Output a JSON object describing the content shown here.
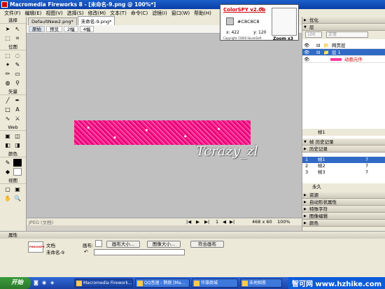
{
  "window": {
    "title": "Macromedia Fireworks 8 - [未命名-9.png @ 100%*]"
  },
  "menu": [
    "文件(F)",
    "编辑(E)",
    "视图(V)",
    "选择(S)",
    "修改(M)",
    "文本(T)",
    "命令(C)",
    "滤镜(I)",
    "窗口(W)",
    "帮助(H)"
  ],
  "tools": {
    "sections": [
      "选择",
      "位图",
      "矢量",
      "Web",
      "颜色",
      "视图"
    ]
  },
  "document": {
    "tabs": [
      "DefaultNew2.png*",
      "未命名-9.png*"
    ],
    "view_buttons": [
      "原始",
      "预览",
      "2幅",
      "4幅"
    ],
    "watermark": "Tcrazy_zl",
    "status": {
      "format": "JPEG (文档)",
      "frame": "1",
      "size": "468 x 60",
      "zoom": "100%"
    }
  },
  "colorspy": {
    "title": "ColorSPY v2.0b",
    "hex": "#C8C8C8",
    "x": "x: 422",
    "y": "y: 120",
    "copyright": "Copyright ?2000 SkunkSoft",
    "zoom_label": "Zoom x3"
  },
  "panels": {
    "optimize": "优化",
    "layers": "层",
    "layers_rows": [
      {
        "name": "网页层"
      },
      {
        "name": "层 1"
      },
      {
        "name": "动画元件"
      }
    ],
    "layers_opacity": "100",
    "layers_blend": "正常",
    "frame_count": "帧1",
    "history_tabs": "帧 历史记录",
    "history_header": "历史记录",
    "history_rows": [
      {
        "n": "1",
        "name": "帧1",
        "d": "7"
      },
      {
        "n": "2",
        "name": "帧2",
        "d": "7"
      },
      {
        "n": "3",
        "name": "帧3",
        "d": "7"
      }
    ],
    "forever": "永久",
    "collapsed": [
      "资源",
      "自动形状属性",
      "特殊字符",
      "图像编辑",
      "颜色"
    ]
  },
  "properties": {
    "header": "属性",
    "doc_label": "文档",
    "doc_name": "未命名-9",
    "canvas_label": "画布:",
    "canvas_size_btn": "画布大小...",
    "image_size_btn": "图像大小...",
    "fit_canvas_btn": "符合画布",
    "thumb_text": "PHOCOSPY"
  },
  "taskbar": {
    "start": "开始",
    "items": [
      "Macromedia Firework...",
      "QQ音速 - 鹊跑 [Ma...",
      "华藻商城",
      "未地相恩"
    ],
    "tray_text": "智可网 www.hzhike.com"
  }
}
